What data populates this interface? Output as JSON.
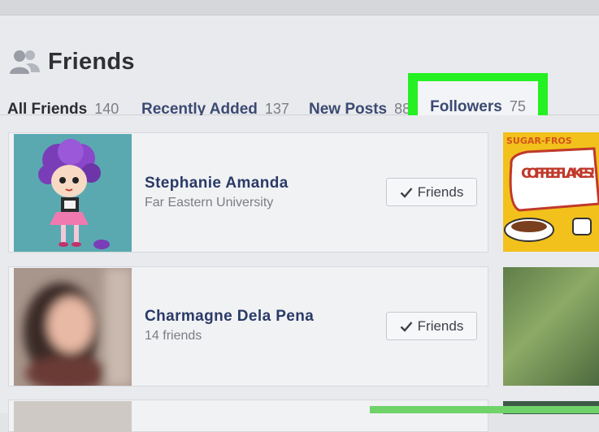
{
  "header": {
    "title": "Friends",
    "icon": "friends-icon"
  },
  "tabs": [
    {
      "label": "All Friends",
      "count": "140",
      "active": true
    },
    {
      "label": "Recently Added",
      "count": "137"
    },
    {
      "label": "New Posts",
      "count": "88"
    },
    {
      "label": "Followers",
      "count": "75",
      "highlighted": true,
      "highlight_color": "#25f022"
    }
  ],
  "friends": [
    {
      "name": "Stephanie Amanda",
      "subtitle": "Far Eastern University",
      "button_label": "Friends"
    },
    {
      "name": "Charmagne Dela Pena",
      "subtitle": "14 friends",
      "button_label": "Friends"
    }
  ],
  "side_images": {
    "sticker_text_top": "SUGAR-FROS",
    "sticker_text_main": "COFFEE FLAKES!"
  },
  "colors": {
    "link": "#2a3a67",
    "highlight": "#25f022",
    "background": "#e9eaee"
  }
}
